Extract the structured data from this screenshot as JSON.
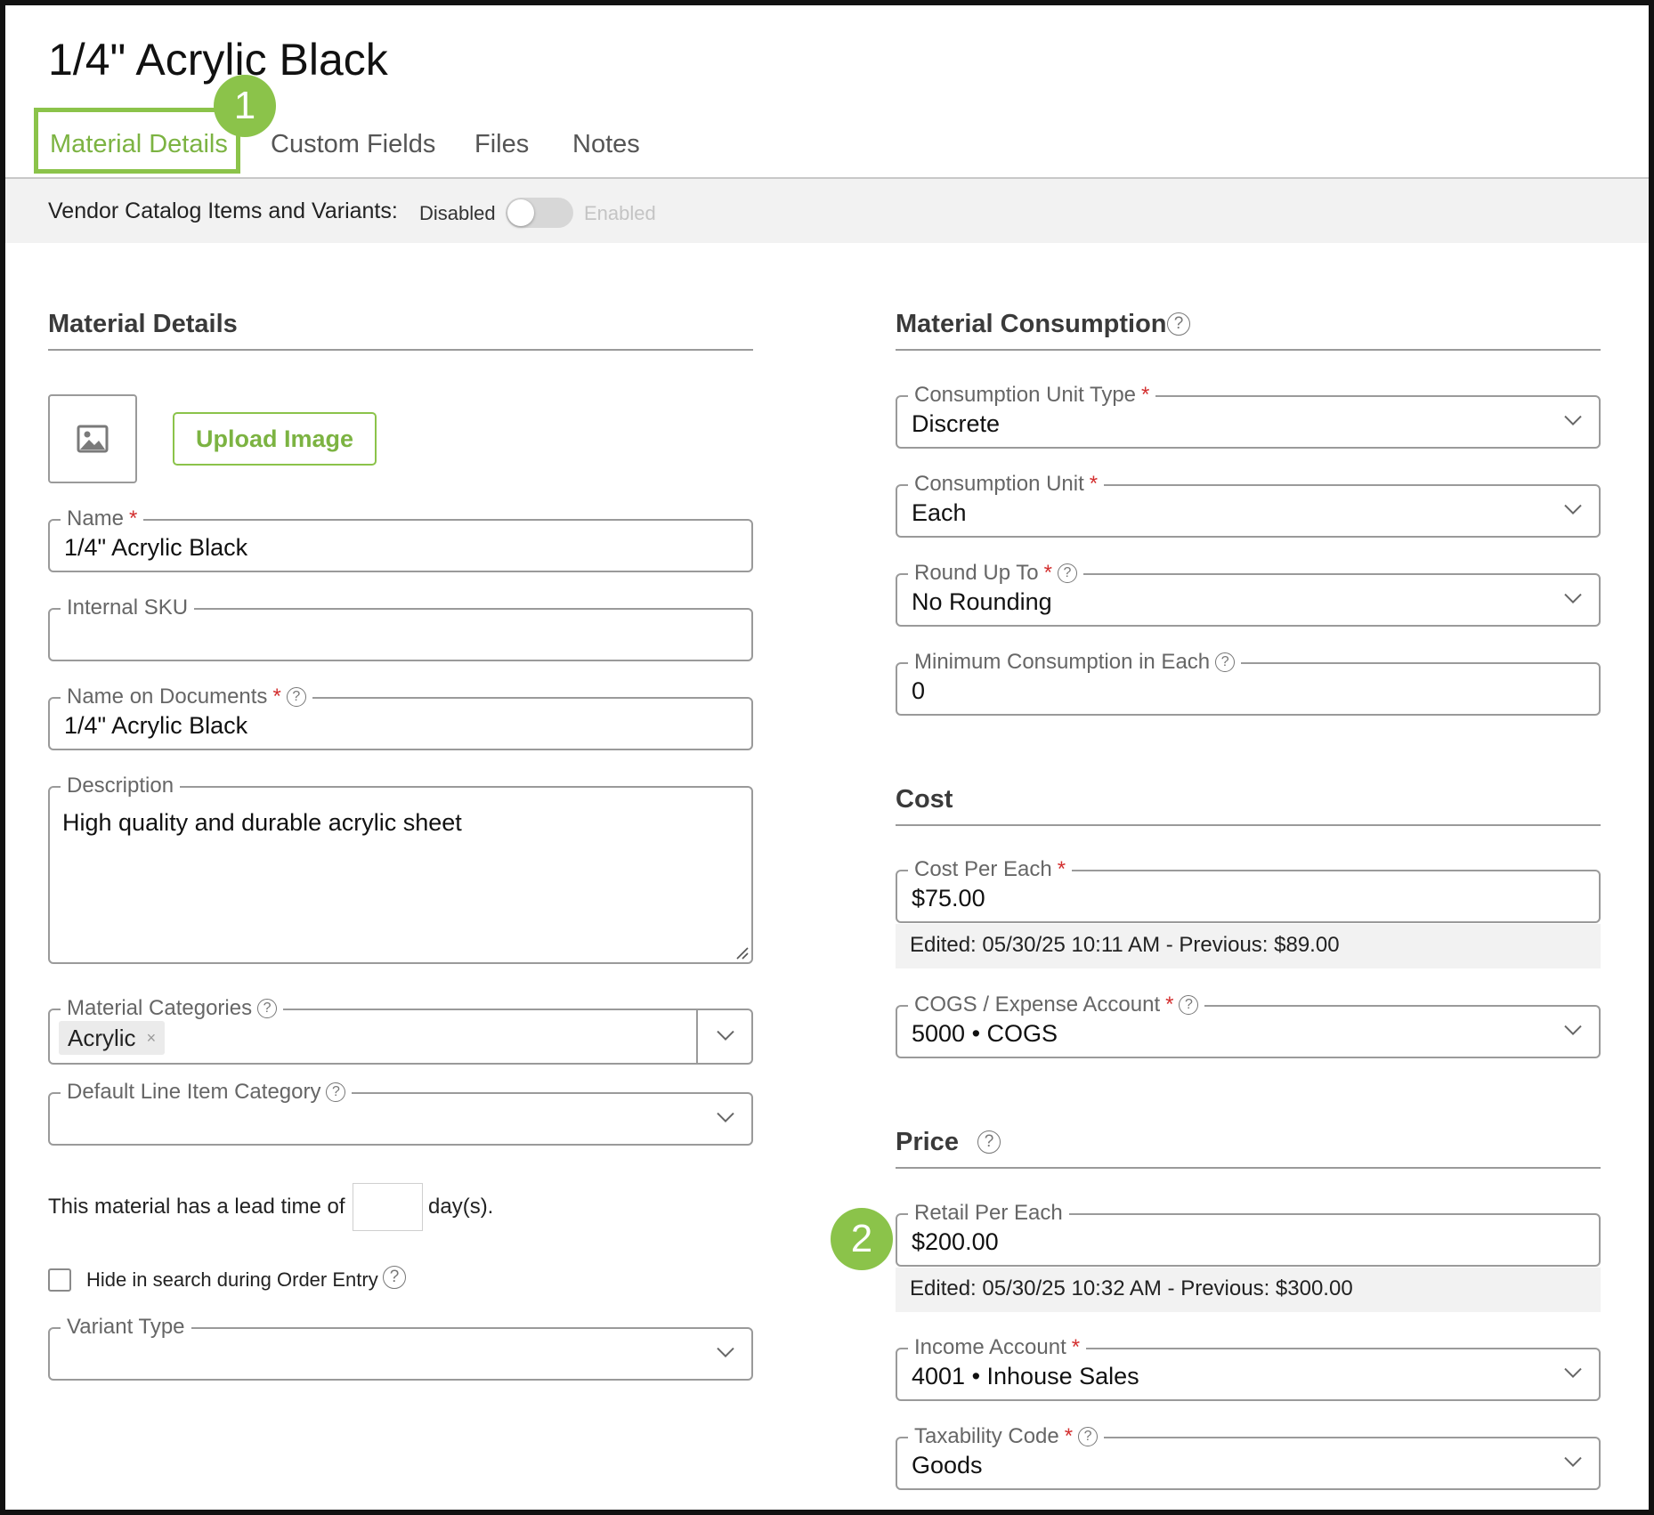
{
  "page_title": "1/4\" Acrylic Black",
  "tabs": [
    {
      "label": "Material Details"
    },
    {
      "label": "Custom Fields"
    },
    {
      "label": "Files"
    },
    {
      "label": "Notes"
    }
  ],
  "badges": {
    "one": "1",
    "two": "2"
  },
  "vendor_toggle": {
    "label": "Vendor Catalog Items and Variants:",
    "off_label": "Disabled",
    "on_label": "Enabled"
  },
  "material_details": {
    "section_title": "Material Details",
    "upload_label": "Upload Image",
    "name": {
      "label": "Name",
      "value": "1/4\" Acrylic Black"
    },
    "internal_sku": {
      "label": "Internal SKU",
      "value": ""
    },
    "name_on_documents": {
      "label": "Name on Documents",
      "value": "1/4\" Acrylic Black"
    },
    "description": {
      "label": "Description",
      "value": "High quality and durable acrylic sheet"
    },
    "material_categories": {
      "label": "Material Categories",
      "chip": "Acrylic",
      "chip_remove": "×"
    },
    "default_line_item_category": {
      "label": "Default Line Item Category",
      "value": ""
    },
    "lead_time": {
      "prefix": "This material has a lead time of",
      "value": "",
      "suffix": "day(s)."
    },
    "hide_in_search": {
      "label": "Hide in search during Order Entry",
      "checked": false
    },
    "variant_type": {
      "label": "Variant Type",
      "value": ""
    }
  },
  "material_consumption": {
    "section_title": "Material Consumption",
    "unit_type": {
      "label": "Consumption Unit Type",
      "value": "Discrete"
    },
    "unit": {
      "label": "Consumption Unit",
      "value": "Each"
    },
    "round_up": {
      "label": "Round Up To",
      "value": "No Rounding"
    },
    "minimum": {
      "label": "Minimum Consumption in Each",
      "value": "0"
    }
  },
  "cost": {
    "section_title": "Cost",
    "cost_per_each": {
      "label": "Cost Per Each",
      "value": "$75.00",
      "edited": "Edited: 05/30/25 10:11 AM - Previous: $89.00"
    },
    "cogs_account": {
      "label": "COGS / Expense Account",
      "value": "5000 • COGS"
    }
  },
  "price": {
    "section_title": "Price",
    "retail_per_each": {
      "label": "Retail Per Each",
      "value": "$200.00",
      "edited": "Edited: 05/30/25 10:32 AM - Previous: $300.00"
    },
    "income_account": {
      "label": "Income Account",
      "value": "4001 • Inhouse Sales"
    },
    "taxability_code": {
      "label": "Taxability Code",
      "value": "Goods"
    }
  },
  "ui": {
    "required_mark": "*",
    "help_glyph": "?"
  },
  "colors": {
    "accent": "#8bc34a",
    "required": "#d32f2f"
  }
}
